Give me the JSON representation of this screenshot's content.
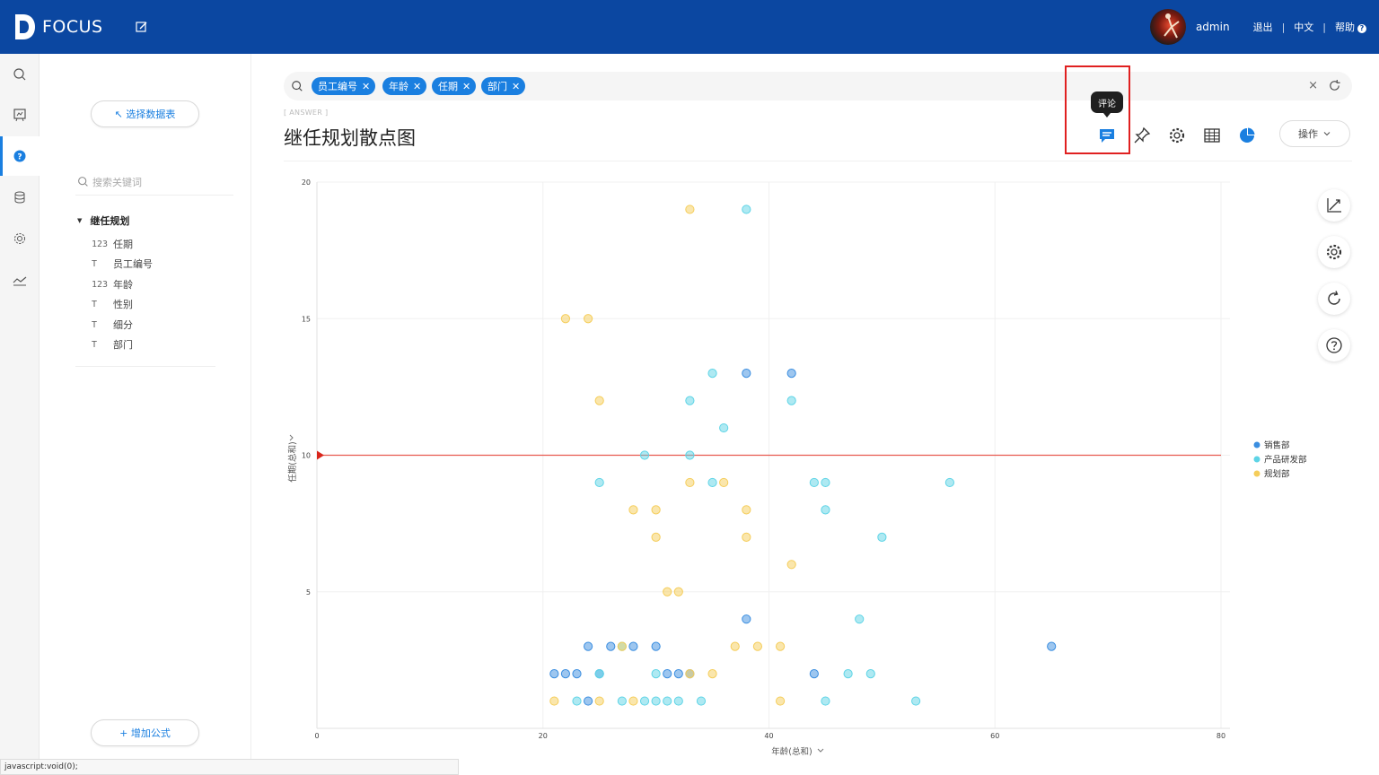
{
  "header": {
    "logo_text": "FOCUS",
    "user_name": "admin",
    "logout": "退出",
    "language": "中文",
    "help": "帮助",
    "help_icon_glyph": "?",
    "separator": "|",
    "bg_color": "#0b47a1"
  },
  "leftbar": {
    "items": [
      {
        "icon": "search-icon"
      },
      {
        "icon": "board-icon"
      },
      {
        "icon": "question-icon",
        "active": true
      },
      {
        "icon": "database-icon"
      },
      {
        "icon": "settings-icon"
      },
      {
        "icon": "trend-icon"
      }
    ]
  },
  "panel": {
    "select_table_label": "↖ 选择数据表",
    "keyword_placeholder": "搜索关键词",
    "tree_root": "继任规划",
    "fields": [
      {
        "icon": "123",
        "label": "任期"
      },
      {
        "icon": "T",
        "label": "员工编号"
      },
      {
        "icon": "123",
        "label": "年龄"
      },
      {
        "icon": "T",
        "label": "性别"
      },
      {
        "icon": "T",
        "label": "细分"
      },
      {
        "icon": "T",
        "label": "部门"
      }
    ],
    "add_formula_label": "+ 增加公式"
  },
  "search": {
    "tags": [
      "员工编号",
      "年龄",
      "任期",
      "部门"
    ],
    "tag_remove_glyph": "✕",
    "clear_glyph": "×"
  },
  "answer": {
    "label": "[ ANSWER ]",
    "title": "继任规划散点图",
    "tooltip": "评论",
    "ops_label": "操作"
  },
  "status_bar": {
    "text": "javascript:void(0);"
  },
  "chart_data": {
    "type": "scatter",
    "xlabel": "年龄(总和)",
    "ylabel": "任期(总和)",
    "xlim": [
      0,
      80
    ],
    "ylim": [
      0,
      20
    ],
    "x_ticks": [
      "0",
      "20",
      "40",
      "60",
      "80"
    ],
    "y_ticks": [
      "5",
      "10",
      "15",
      "20"
    ],
    "reference_line_y": 10,
    "legend_position": "right",
    "series": [
      {
        "name": "销售部",
        "color": "#3b8ee0",
        "points": [
          [
            38,
            13
          ],
          [
            42,
            13
          ],
          [
            38,
            4
          ],
          [
            65,
            3
          ],
          [
            24,
            3
          ],
          [
            26,
            3
          ],
          [
            28,
            3
          ],
          [
            30,
            3
          ],
          [
            21,
            2
          ],
          [
            22,
            2
          ],
          [
            23,
            2
          ],
          [
            25,
            2
          ],
          [
            31,
            2
          ],
          [
            32,
            2
          ],
          [
            33,
            2
          ],
          [
            44,
            2
          ],
          [
            24,
            1
          ]
        ]
      },
      {
        "name": "产品研发部",
        "color": "#5ed4e6",
        "points": [
          [
            38,
            19
          ],
          [
            35,
            13
          ],
          [
            33,
            12
          ],
          [
            42,
            12
          ],
          [
            36,
            11
          ],
          [
            29,
            10
          ],
          [
            33,
            10
          ],
          [
            25,
            9
          ],
          [
            35,
            9
          ],
          [
            44,
            9
          ],
          [
            45,
            9
          ],
          [
            56,
            9
          ],
          [
            45,
            8
          ],
          [
            50,
            7
          ],
          [
            48,
            4
          ],
          [
            27,
            3
          ],
          [
            25,
            2
          ],
          [
            30,
            2
          ],
          [
            47,
            2
          ],
          [
            49,
            2
          ],
          [
            23,
            1
          ],
          [
            27,
            1
          ],
          [
            29,
            1
          ],
          [
            30,
            1
          ],
          [
            31,
            1
          ],
          [
            32,
            1
          ],
          [
            34,
            1
          ],
          [
            45,
            1
          ],
          [
            53,
            1
          ]
        ]
      },
      {
        "name": "规划部",
        "color": "#f5cd5a",
        "points": [
          [
            33,
            19
          ],
          [
            22,
            15
          ],
          [
            24,
            15
          ],
          [
            25,
            12
          ],
          [
            33,
            9
          ],
          [
            36,
            9
          ],
          [
            28,
            8
          ],
          [
            30,
            8
          ],
          [
            38,
            8
          ],
          [
            30,
            7
          ],
          [
            38,
            7
          ],
          [
            42,
            6
          ],
          [
            31,
            5
          ],
          [
            32,
            5
          ],
          [
            27,
            3
          ],
          [
            37,
            3
          ],
          [
            39,
            3
          ],
          [
            41,
            3
          ],
          [
            33,
            2
          ],
          [
            35,
            2
          ],
          [
            21,
            1
          ],
          [
            25,
            1
          ],
          [
            28,
            1
          ],
          [
            41,
            1
          ]
        ]
      }
    ]
  }
}
